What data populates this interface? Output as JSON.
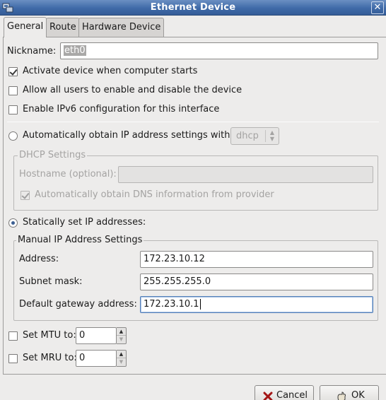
{
  "window": {
    "title": "Ethernet Device",
    "close_glyph": "✕"
  },
  "tabs": [
    {
      "label": "General",
      "accesskey_index": 0,
      "active": true
    },
    {
      "label": "Route",
      "accesskey_index": 0,
      "active": false
    },
    {
      "label": "Hardware Device",
      "accesskey_index": 0,
      "active": false
    }
  ],
  "general": {
    "nickname_label": "Nickname:",
    "nickname_value": "eth0",
    "activate_on_start": {
      "label": "Activate device when computer starts",
      "checked": true
    },
    "allow_all_users": {
      "label": "Allow all users to enable and disable the device",
      "checked": false
    },
    "enable_ipv6": {
      "label": "Enable IPv6 configuration for this interface",
      "checked": false
    },
    "auto_ip": {
      "label": "Automatically obtain IP address settings with:",
      "selected": false,
      "method": "dhcp"
    },
    "dhcp_settings": {
      "title": "DHCP Settings",
      "hostname_label": "Hostname (optional):",
      "hostname_value": "",
      "auto_dns": {
        "label": "Automatically obtain DNS information from provider",
        "checked": true
      }
    },
    "static_ip": {
      "label": "Statically set IP addresses:",
      "selected": true
    },
    "manual_settings": {
      "title": "Manual IP Address Settings",
      "address_label": "Address:",
      "address_value": "172.23.10.12",
      "subnet_label": "Subnet mask:",
      "subnet_value": "255.255.255.0",
      "gateway_label": "Default gateway address:",
      "gateway_value": "172.23.10.1"
    },
    "mtu": {
      "label": "Set MTU to:",
      "checked": false,
      "value": "0"
    },
    "mru": {
      "label": "Set MRU to:",
      "checked": false,
      "value": "0"
    }
  },
  "buttons": {
    "cancel": "Cancel",
    "ok": "OK"
  },
  "icons": {
    "app": "network-device-icon",
    "cancel": "cancel-x-icon",
    "ok": "ok-hand-icon"
  },
  "colors": {
    "titlebar": "#3f6aa8",
    "window_bg": "#edeceb",
    "focus_border": "#5580b8"
  }
}
